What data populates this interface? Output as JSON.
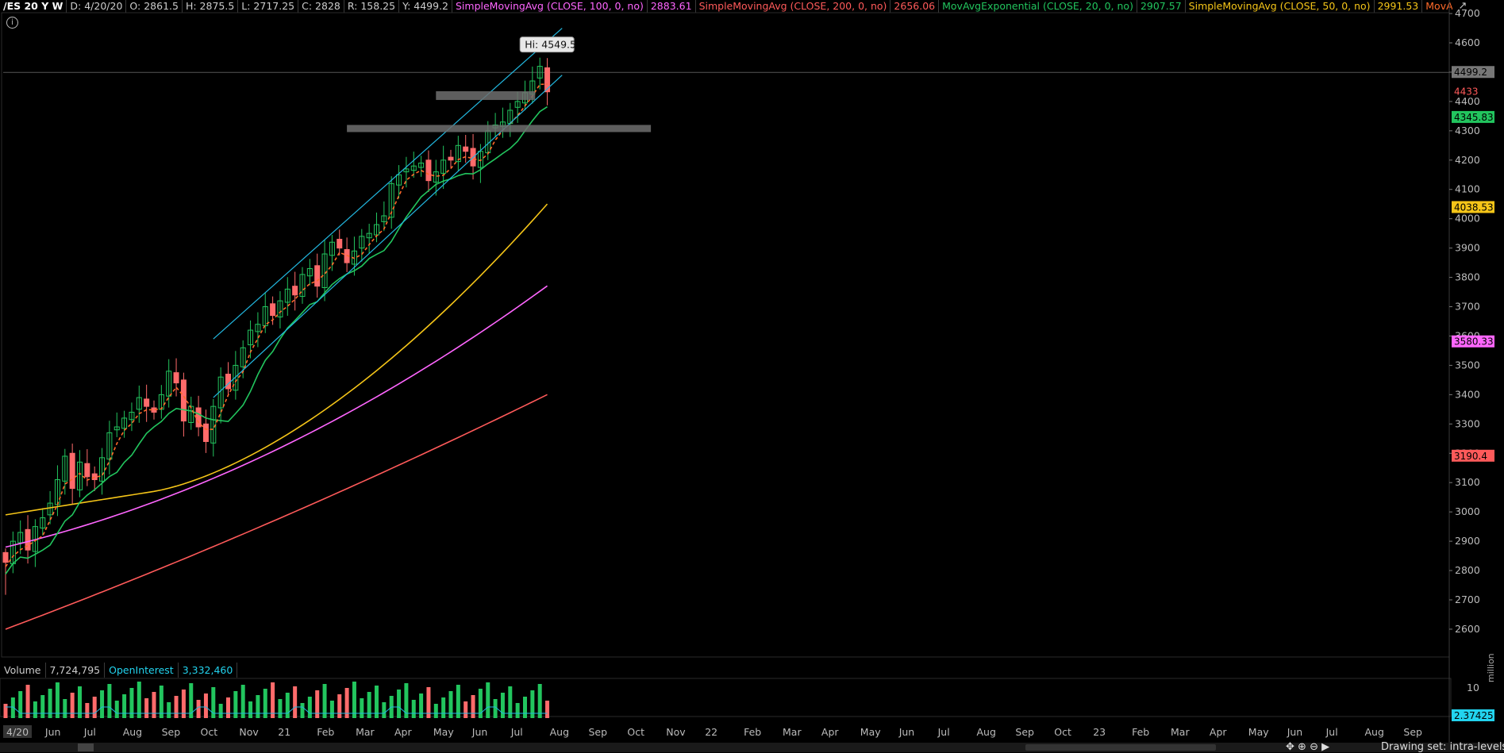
{
  "header": {
    "symbol": "/ES 20 Y W",
    "date": "D: 4/20/20",
    "open": "O: 2861.5",
    "high": "H: 2875.5",
    "low": "L: 2717.25",
    "close": "C: 2828",
    "range": "R: 158.25",
    "last": "Y: 4499.2",
    "studies": [
      {
        "label": "SimpleMovingAvg (CLOSE, 100, 0, no)",
        "value": "2883.61",
        "color": "#ff66ff"
      },
      {
        "label": "SimpleMovingAvg (CLOSE, 200, 0, no)",
        "value": "2656.06",
        "color": "#ff5a5a"
      },
      {
        "label": "MovAvgExponential (CLOSE, 20, 0, no)",
        "value": "2907.57",
        "color": "#22c55e"
      },
      {
        "label": "SimpleMovingAvg (CLOSE, 50, 0, no)",
        "value": "2991.53",
        "color": "#f5c518"
      },
      {
        "label": "MovAvgExponential (CLOSE,...",
        "value": "",
        "color": "#ff6a2a"
      }
    ]
  },
  "hi_label": "Hi: 4549.5",
  "price_axis": {
    "ticks": [
      "4700",
      "4600",
      "4500",
      "4400",
      "4300",
      "4200",
      "4100",
      "4000",
      "3900",
      "3800",
      "3700",
      "3600",
      "3500",
      "3400",
      "3300",
      "3200",
      "3100",
      "3000",
      "2900",
      "2800",
      "2700",
      "2600"
    ],
    "badges": [
      {
        "text": "4499.2",
        "bg": "#777777",
        "fg": "#000000",
        "price": 4499.2
      },
      {
        "text": "4433",
        "bg": "#000000",
        "fg": "#ff5a5a",
        "price": 4433
      },
      {
        "text": "4345.83",
        "bg": "#22c55e",
        "fg": "#000000",
        "price": 4345.83
      },
      {
        "text": "4038.53",
        "bg": "#f5c518",
        "fg": "#000000",
        "price": 4038.53
      },
      {
        "text": "3580.33",
        "bg": "#ff66ff",
        "fg": "#000000",
        "price": 3580.33
      },
      {
        "text": "3190.4",
        "bg": "#ff5a5a",
        "fg": "#000000",
        "price": 3190.4
      }
    ]
  },
  "time_axis": {
    "labels": [
      "4/20",
      "Jun",
      "Jul",
      "Aug",
      "Sep",
      "Oct",
      "Nov",
      "21",
      "Feb",
      "Mar",
      "Apr",
      "May",
      "Jun",
      "Jul",
      "Aug",
      "Sep",
      "Oct",
      "Nov",
      "22",
      "Feb",
      "Mar",
      "Apr",
      "May",
      "Jun",
      "Jul",
      "Aug",
      "Sep",
      "Oct",
      "23",
      "Feb",
      "Mar",
      "Apr",
      "May",
      "Jun",
      "Jul",
      "Aug",
      "Sep"
    ]
  },
  "volume": {
    "label": "Volume",
    "value": "7,724,795",
    "oi_label": "OpenInterest",
    "oi_value": "3,332,460",
    "axis_tick": "10",
    "axis_badge": "2.37425",
    "unit": "million"
  },
  "colors": {
    "up": "#22c55e",
    "down": "#ff6b6b",
    "channel": "#22b8e0",
    "sma100": "#ff66ff",
    "sma200": "#ff5a5a",
    "ema20": "#22c55e",
    "sma50": "#f5c518",
    "ema_fast": "#ff6a2a"
  },
  "bottom": {
    "drawing_set": "Drawing set: intra-levels"
  }
}
